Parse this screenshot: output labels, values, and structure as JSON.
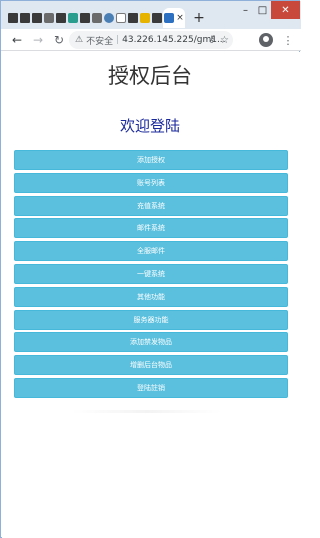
{
  "browser": {
    "tabs": [
      {
        "icon": "app-favicon-icon"
      },
      {
        "icon": "app-favicon-icon"
      },
      {
        "icon": "app-favicon-icon"
      },
      {
        "icon": "app-favicon-icon"
      },
      {
        "icon": "app-favicon-icon"
      },
      {
        "icon": "globe-icon"
      },
      {
        "icon": "app-favicon-icon"
      },
      {
        "icon": "app-favicon-icon"
      },
      {
        "icon": "gear-icon"
      },
      {
        "icon": "document-icon"
      },
      {
        "icon": "app-favicon-icon"
      },
      {
        "icon": "folder-icon"
      },
      {
        "icon": "app-favicon-icon"
      },
      {
        "icon": "app-favicon-icon"
      }
    ],
    "active_tab_close": "×",
    "new_tab": "+",
    "window_controls": {
      "minimize": "–",
      "maximize": "□",
      "close": "✕"
    },
    "nav": {
      "back": "←",
      "forward": "→",
      "reload": "↻"
    },
    "address": {
      "insecure_label": "不安全",
      "separator": "|",
      "url": "43.226.145.225/gm1..."
    },
    "menu_glyph": "⋮"
  },
  "page": {
    "title": "授权后台",
    "login_title": "欢迎登陆",
    "buttons": [
      "添加授权",
      "账号列表",
      "充值系统",
      "邮件系统",
      "全服邮件",
      "一键系统",
      "其他功能",
      "服务器功能",
      "添加禁发物品",
      "增删后台物品",
      "登陆註销"
    ]
  },
  "colors": {
    "button_bg": "#5bc0de",
    "button_text": "#ffffff",
    "login_title": "#1b2a9b",
    "close_button": "#c9483c"
  }
}
